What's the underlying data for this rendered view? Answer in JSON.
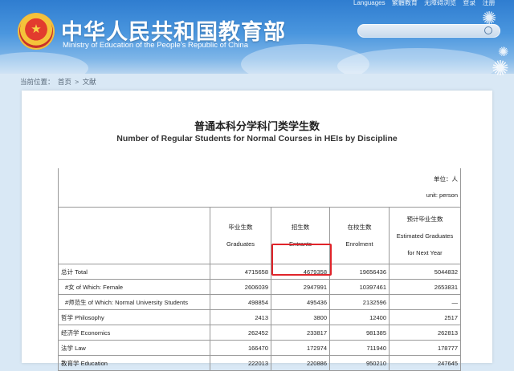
{
  "header": {
    "site_name_cn": "中华人民共和国教育部",
    "site_name_en": "Ministry of Education of the People's Republic of China",
    "top_nav": [
      "Languages",
      "繁體教育",
      "无障碍浏览",
      "登录",
      "注册"
    ],
    "search": {
      "placeholder": "",
      "value": ""
    }
  },
  "breadcrumb": {
    "prefix": "当前位置：",
    "home": "首页",
    "separator": ">",
    "current": "文献"
  },
  "document": {
    "title_cn": "普通本科分学科门类学生数",
    "title_en": "Number of Regular Students for Normal Courses in HEIs by Discipline",
    "unit_cn": "单位：人",
    "unit_en": "unit: person",
    "columns": [
      {
        "cn": "毕业生数",
        "en": "Graduates"
      },
      {
        "cn": "招生数",
        "en": "Entrants"
      },
      {
        "cn": "在校生数",
        "en": "Enrolment"
      },
      {
        "cn": "预计毕业生数",
        "en": "Estimated Graduates",
        "en2": "for Next Year"
      }
    ],
    "rows": [
      {
        "label": "总计 Total",
        "values": [
          "4715658",
          "4679358",
          "19656436",
          "5044832"
        ]
      },
      {
        "label": "#女 of Which: Female",
        "values": [
          "2606039",
          "2947991",
          "10397461",
          "2653831"
        ]
      },
      {
        "label": "#师范生 of Which: Normal University Students",
        "values": [
          "498854",
          "495436",
          "2132596",
          "—"
        ]
      },
      {
        "label": "哲学 Philosophy",
        "values": [
          "2413",
          "3800",
          "12400",
          "2517"
        ]
      },
      {
        "label": "经济学 Economics",
        "values": [
          "262452",
          "233817",
          "981385",
          "262813"
        ]
      },
      {
        "label": "法学 Law",
        "values": [
          "166470",
          "172974",
          "711940",
          "178777"
        ]
      },
      {
        "label": "教育学 Education",
        "values": [
          "222013",
          "220886",
          "950210",
          "247645"
        ]
      }
    ]
  },
  "colors": {
    "header_blue": "#2f7dd0",
    "highlight_red": "#e0242a"
  }
}
